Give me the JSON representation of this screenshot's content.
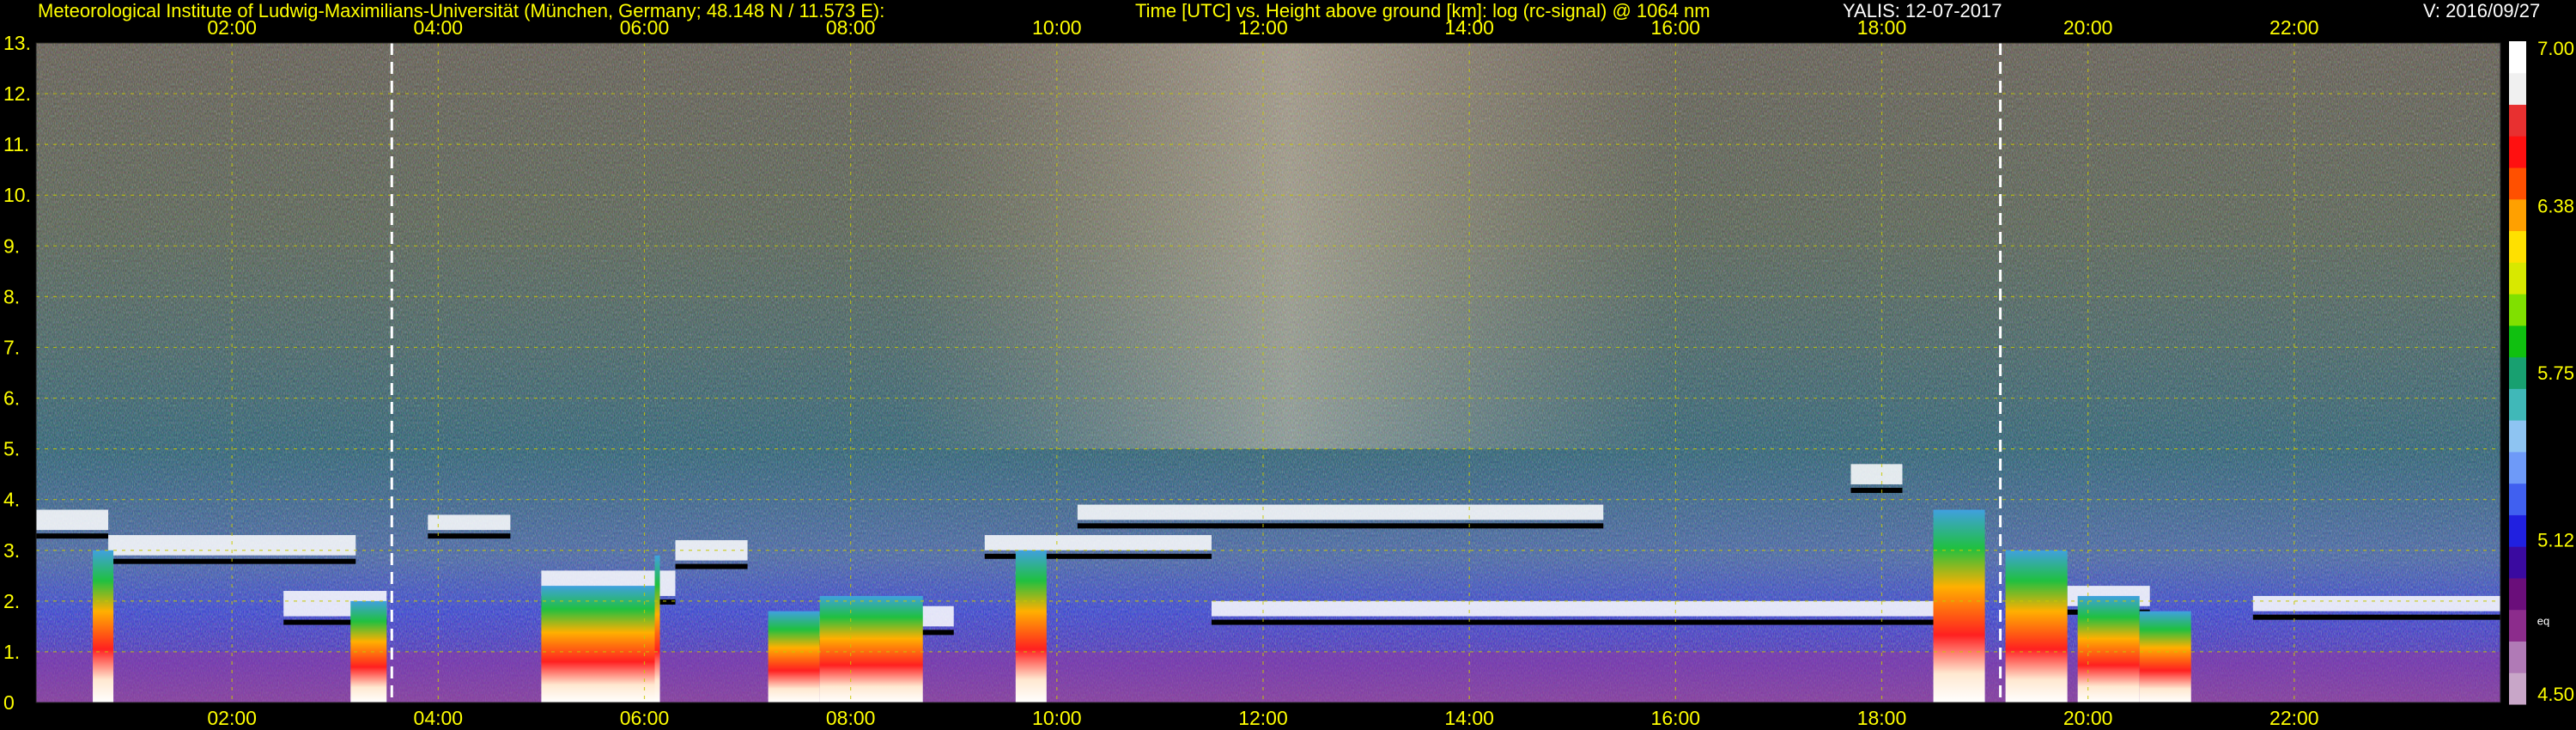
{
  "header": {
    "institute": "Meteorological Institute of Ludwig-Maximilians-Universität (München, Germany; 48.148 N / 11.573 E):",
    "plot_description": "Time [UTC] vs. Height above ground [km]: log (rc-signal) @ 1064 nm",
    "instrument_date": "YALIS: 12-07-2017",
    "version": "V: 2016/09/27"
  },
  "colors": {
    "background": "#000000",
    "header_text_yellow": "#ffff00",
    "header_text_white": "#ffffff",
    "grid_yellow": "#c8c800",
    "marker_line": "#ffffff"
  },
  "chart_data": {
    "type": "heatmap",
    "title": "Time [UTC] vs. Height above ground [km]: log (rc-signal) @ 1064 nm",
    "xlabel": "Time [UTC]",
    "ylabel": "Height above ground [km]",
    "x_range_hours": [
      0.1,
      24.0
    ],
    "x_ticks": [
      "02:00",
      "04:00",
      "06:00",
      "08:00",
      "10:00",
      "12:00",
      "14:00",
      "16:00",
      "18:00",
      "20:00",
      "22:00"
    ],
    "x_tick_hours": [
      2,
      4,
      6,
      8,
      10,
      12,
      14,
      16,
      18,
      20,
      22
    ],
    "y_range_km": [
      0,
      13
    ],
    "y_ticks": [
      "0",
      "1.",
      "2.",
      "3.",
      "4.",
      "5.",
      "6.",
      "7.",
      "8.",
      "9.",
      "10.",
      "11.",
      "12.",
      "13."
    ],
    "grid": true,
    "vertical_markers_hours": [
      3.55,
      19.15
    ],
    "colorbar": {
      "min": 4.5,
      "max": 7.0,
      "tick_labels": [
        "7.00",
        "6.38",
        "5.75",
        "5.12",
        "4.50"
      ],
      "tick_values": [
        7.0,
        6.38,
        5.75,
        5.12,
        4.5
      ],
      "extra_label": "eq",
      "colors": [
        "#c8a6c8",
        "#b07ab6",
        "#8c2c8c",
        "#6a0e7a",
        "#3a0aa0",
        "#2020e0",
        "#4060f0",
        "#6e9af8",
        "#8ec4f2",
        "#40b8b8",
        "#18a070",
        "#10c010",
        "#80e000",
        "#d8e800",
        "#ffe000",
        "#ffa000",
        "#ff5000",
        "#ff1010",
        "#e83030",
        "#f0f0f0",
        "#ffffff"
      ]
    },
    "cloud_layers": [
      {
        "t0": 0.1,
        "t1": 0.8,
        "base_km": 3.4,
        "top_km": 3.8
      },
      {
        "t0": 0.8,
        "t1": 3.2,
        "base_km": 2.9,
        "top_km": 3.3
      },
      {
        "t0": 2.5,
        "t1": 3.5,
        "base_km": 1.7,
        "top_km": 2.2
      },
      {
        "t0": 3.9,
        "t1": 4.7,
        "base_km": 3.4,
        "top_km": 3.7
      },
      {
        "t0": 5.0,
        "t1": 6.3,
        "base_km": 2.1,
        "top_km": 2.6
      },
      {
        "t0": 6.3,
        "t1": 7.0,
        "base_km": 2.8,
        "top_km": 3.2
      },
      {
        "t0": 7.3,
        "t1": 8.6,
        "base_km": 1.3,
        "top_km": 1.7
      },
      {
        "t0": 8.6,
        "t1": 9.0,
        "base_km": 1.5,
        "top_km": 1.9
      },
      {
        "t0": 9.3,
        "t1": 11.5,
        "base_km": 3.0,
        "top_km": 3.3
      },
      {
        "t0": 10.2,
        "t1": 15.3,
        "base_km": 3.6,
        "top_km": 3.9
      },
      {
        "t0": 11.5,
        "t1": 18.6,
        "base_km": 1.7,
        "top_km": 2.0
      },
      {
        "t0": 17.7,
        "t1": 18.2,
        "base_km": 4.3,
        "top_km": 4.7
      },
      {
        "t0": 19.8,
        "t1": 20.6,
        "base_km": 1.9,
        "top_km": 2.3
      },
      {
        "t0": 21.6,
        "t1": 24.0,
        "base_km": 1.8,
        "top_km": 2.1
      }
    ],
    "precip_columns": [
      {
        "t0": 0.65,
        "t1": 0.85,
        "top_km": 3.0
      },
      {
        "t0": 3.15,
        "t1": 3.5,
        "top_km": 2.0
      },
      {
        "t0": 5.0,
        "t1": 6.1,
        "top_km": 2.3
      },
      {
        "t0": 6.1,
        "t1": 6.1,
        "top_km": 2.9
      },
      {
        "t0": 7.2,
        "t1": 7.7,
        "top_km": 1.8
      },
      {
        "t0": 7.7,
        "t1": 8.7,
        "top_km": 2.1
      },
      {
        "t0": 9.6,
        "t1": 9.9,
        "top_km": 3.0
      },
      {
        "t0": 18.5,
        "t1": 19.0,
        "top_km": 3.8
      },
      {
        "t0": 19.2,
        "t1": 19.8,
        "top_km": 3.0
      },
      {
        "t0": 19.9,
        "t1": 20.5,
        "top_km": 2.1
      },
      {
        "t0": 20.5,
        "t1": 21.0,
        "top_km": 1.8
      }
    ]
  }
}
